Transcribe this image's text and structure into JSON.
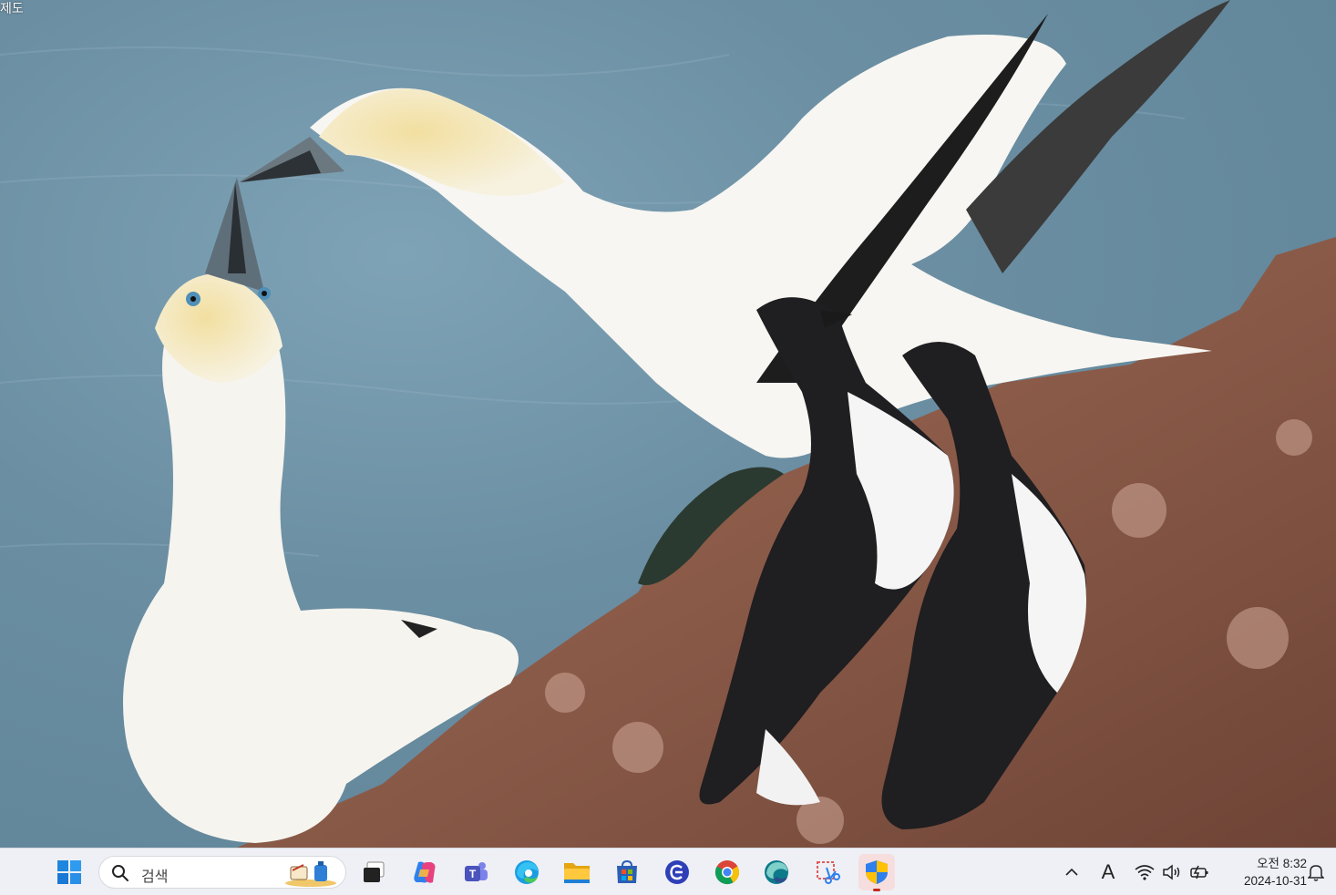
{
  "desktop": {
    "corner_text": "제도"
  },
  "taskbar": {
    "start_label": "Start",
    "search": {
      "placeholder": "검색"
    },
    "apps": [
      {
        "name": "Task View"
      },
      {
        "name": "Copilot"
      },
      {
        "name": "Microsoft Teams"
      },
      {
        "name": "Microsoft Edge"
      },
      {
        "name": "File Explorer"
      },
      {
        "name": "Microsoft Store"
      },
      {
        "name": "App"
      },
      {
        "name": "Google Chrome"
      },
      {
        "name": "Edge Beta"
      },
      {
        "name": "Snipping Tool"
      },
      {
        "name": "Windows Security"
      }
    ],
    "tray": {
      "ime_indicator": "A",
      "time": "오전 8:32",
      "date": "2024-10-31"
    }
  },
  "colors": {
    "taskbar_bg": "#eef0f5",
    "active_highlight": "#f7dede",
    "accent_blue": "#0078d4"
  }
}
